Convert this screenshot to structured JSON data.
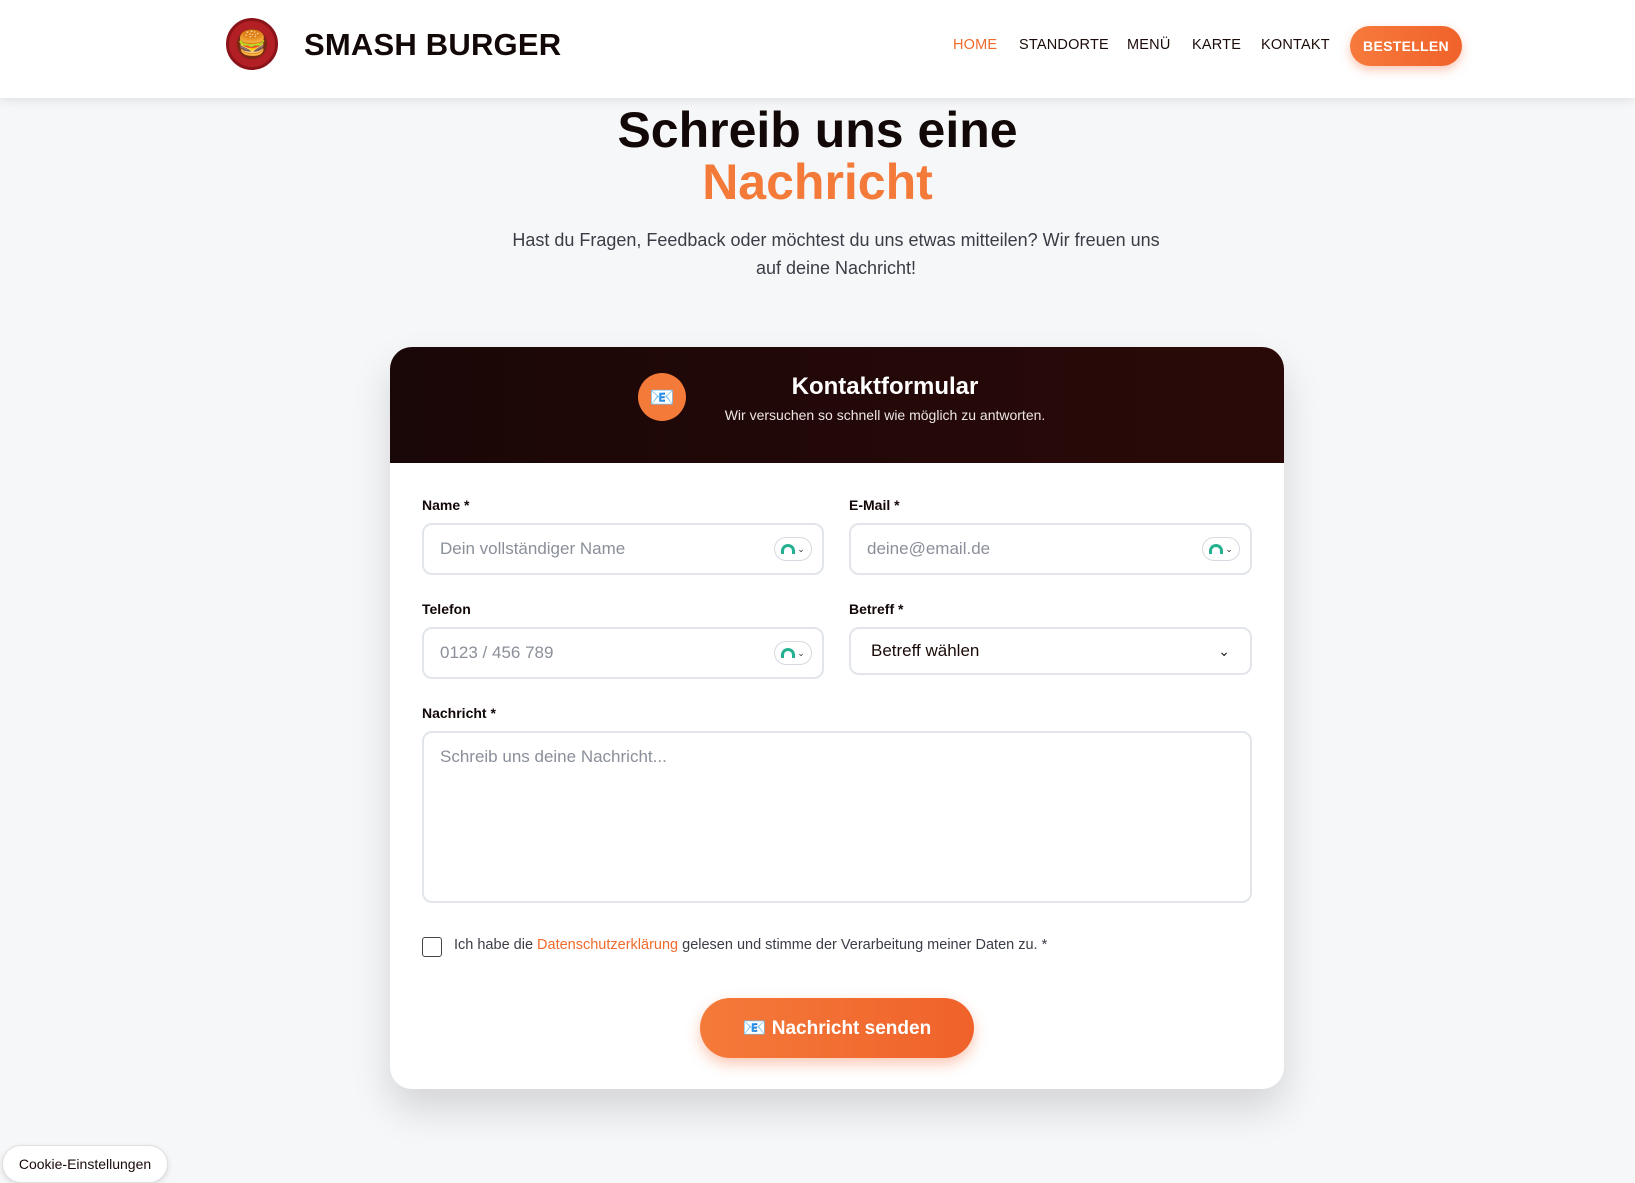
{
  "navbar": {
    "logo_icon": "🍔",
    "brand": "SMASH BURGER",
    "links": [
      {
        "label": "HOME",
        "active": true
      },
      {
        "label": "STANDORTE",
        "active": false
      },
      {
        "label": "MENÜ",
        "active": false
      },
      {
        "label": "KARTE",
        "active": false
      },
      {
        "label": "KONTAKT",
        "active": false
      }
    ],
    "order_label": "BESTELLEN"
  },
  "hero": {
    "title": "Schreib uns eine",
    "title_accent": "Nachricht",
    "subtitle": "Hast du Fragen, Feedback oder möchtest du uns etwas mitteilen? Wir freuen uns auf deine Nachricht!"
  },
  "form": {
    "header_icon": "📧",
    "header_title": "Kontaktformular",
    "header_subtitle": "Wir versuchen so schnell wie möglich zu antworten.",
    "name": {
      "label": "Name *",
      "placeholder": "Dein vollständiger Name",
      "value": ""
    },
    "email": {
      "label": "E-Mail *",
      "placeholder": "deine@email.de",
      "value": ""
    },
    "phone": {
      "label": "Telefon",
      "placeholder": "0123 / 456 789",
      "value": ""
    },
    "subject": {
      "label": "Betreff *",
      "selected": "Betreff wählen"
    },
    "message": {
      "label": "Nachricht *",
      "placeholder": "Schreib uns deine Nachricht...",
      "value": ""
    },
    "consent": {
      "prefix": "Ich habe die ",
      "link": "Datenschutzerklärung",
      "suffix": " gelesen und stimme der Verarbeitung meiner Daten zu. *",
      "checked": false
    },
    "submit_label": "📧 Nachricht senden"
  },
  "cookie": {
    "label": "Cookie-Einstellungen"
  },
  "colors": {
    "accent": "#f47a3a",
    "header_bg": "#1a0707",
    "text_dark": "#120807"
  }
}
